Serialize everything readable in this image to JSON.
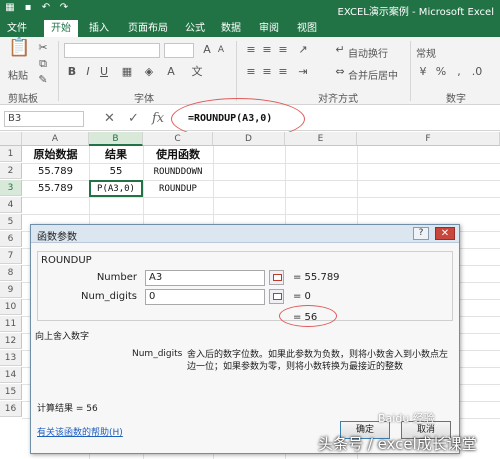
{
  "window": {
    "title": "EXCEL演示案例 - Microsoft Excel"
  },
  "ribbon": {
    "file_tab": "文件",
    "tabs": [
      "开始",
      "插入",
      "页面布局",
      "公式",
      "数据",
      "审阅",
      "视图"
    ],
    "active_tab": "开始",
    "groups": [
      "剪贴板",
      "字体",
      "对齐方式",
      "数字"
    ],
    "paste_label": "粘贴",
    "wrap_text": "自动换行",
    "merge_center": "合并后居中",
    "number_format": "常规",
    "bold": "B",
    "italic": "I",
    "underline": "U"
  },
  "formula_bar": {
    "name_box": "B3",
    "cancel": "✕",
    "enter": "✓",
    "fx": "fx",
    "formula": "=ROUNDUP(A3,0)"
  },
  "sheet": {
    "columns": [
      "A",
      "B",
      "C",
      "D",
      "E",
      "F"
    ],
    "rows": [
      "1",
      "2",
      "3",
      "4",
      "5",
      "6",
      "7",
      "8",
      "9",
      "10",
      "11",
      "12",
      "13",
      "14",
      "15",
      "16"
    ],
    "cells": {
      "A1": "原始数据",
      "B1": "结果",
      "C1": "使用函数",
      "A2": "55.789",
      "B2": "55",
      "C2": "ROUNDDOWN",
      "A3": "55.789",
      "B3": "P(A3,0)",
      "C3": "ROUNDUP"
    }
  },
  "dialog": {
    "title": "函数参数",
    "help_button": "?",
    "close_button": "✕",
    "function_name": "ROUNDUP",
    "args": [
      {
        "label": "Number",
        "value": "A3",
        "result": "=  55.789"
      },
      {
        "label": "Num_digits",
        "value": "0",
        "result": "=  0"
      }
    ],
    "function_result": "=  56",
    "description": "向上舍入数字",
    "arg_desc_name": "Num_digits",
    "arg_desc": "舍入后的数字位数。如果此参数为负数，则将小数舍入到小数点左边一位；如果参数为零，则将小数转换为最接近的整数",
    "calc_result": "计算结果 =   56",
    "help_link": "有关该函数的帮助(H)",
    "ok_label": "确定",
    "cancel_label": "取消"
  },
  "watermark": {
    "text": "头条号 / excel成长课堂",
    "baidu": "Baidu 经验"
  }
}
